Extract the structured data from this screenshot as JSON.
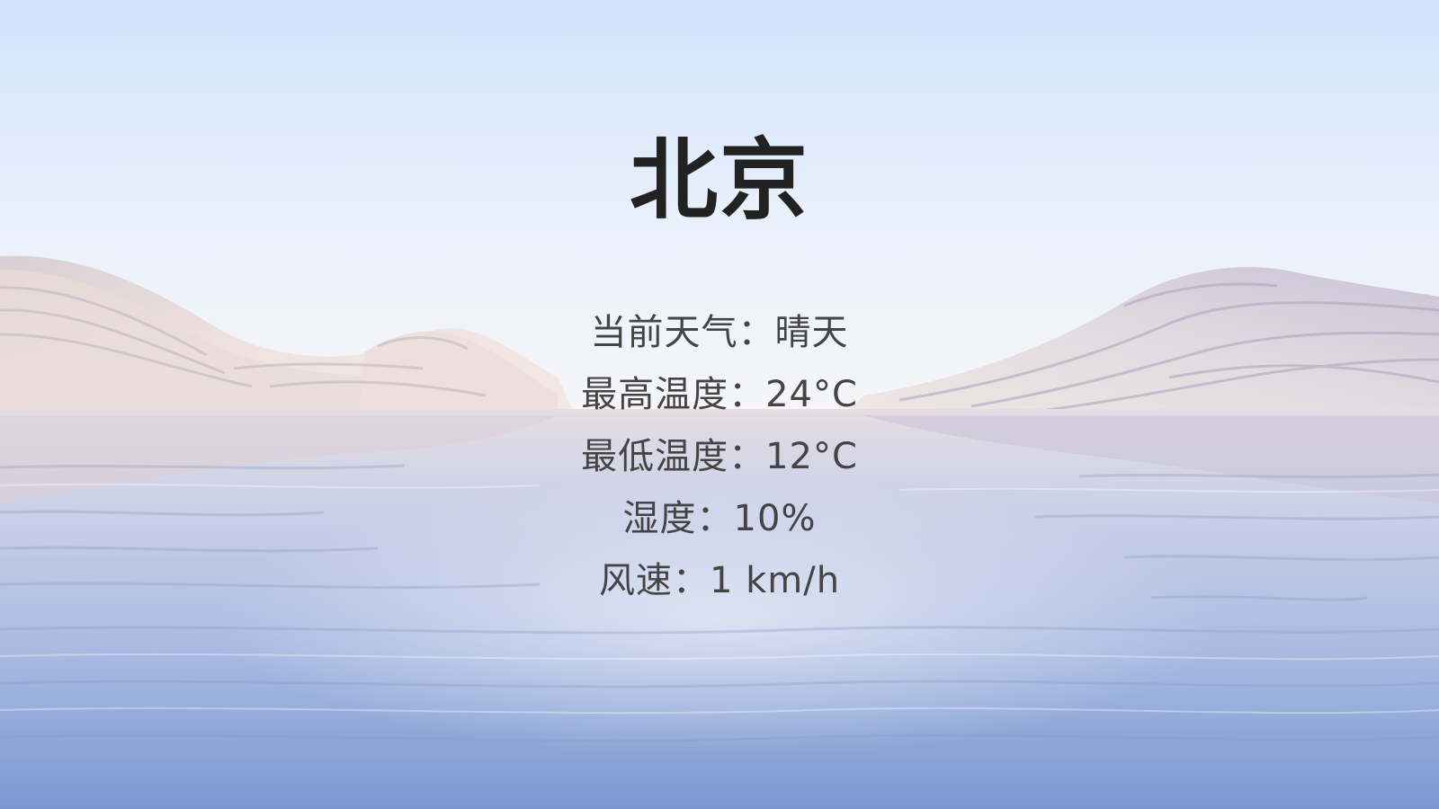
{
  "city": "北京",
  "weather": {
    "rows": [
      {
        "label": "当前天气：",
        "value": "晴天"
      },
      {
        "label": "最高温度：",
        "value": "24°C"
      },
      {
        "label": "最低温度：",
        "value": "12°C"
      },
      {
        "label": "湿度：",
        "value": "10%"
      },
      {
        "label": "风速：",
        "value": "1 km/h"
      }
    ]
  },
  "colors": {
    "sky_top": "#d2e4fb",
    "sky_bottom": "#f3f6fb",
    "dune_light": "#ece1de",
    "dune_shadow": "#b8b3c9",
    "water_top": "#d6d9ea",
    "water_bottom": "#7d9ad0",
    "title": "#222222",
    "text": "#444444"
  }
}
